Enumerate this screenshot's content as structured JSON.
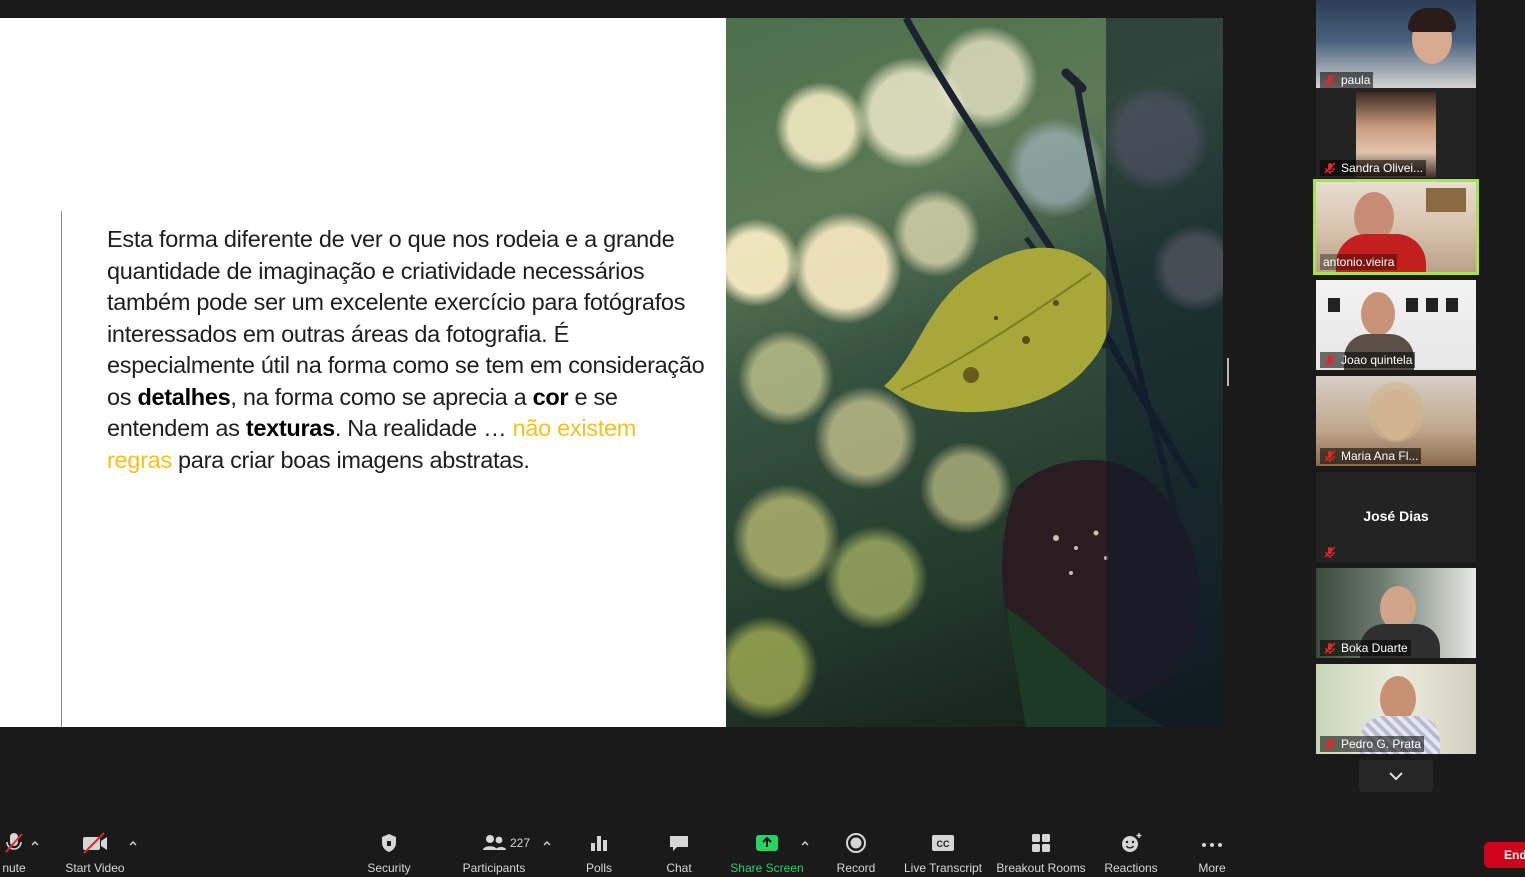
{
  "slide": {
    "text_parts": {
      "p1": "Esta forma diferente de ver o que nos rodeia e a grande quantidade de imaginação e criatividade necessários também pode ser um excelente exercício para fotógrafos interessados em outras áreas da fotografia. É especialmente útil na forma como se tem em consideração os ",
      "b1": "detalhes",
      "p2": ", na forma como se aprecia a ",
      "b2": "cor",
      "p3": " e se entendem as ",
      "b3": "texturas",
      "p4": ". Na realidade … ",
      "hl": "não existem regras",
      "p5": " para criar boas imagens abstratas."
    },
    "photo_alt": "bokeh leaf photo",
    "highlight_color": "#f2c11c"
  },
  "participants": [
    {
      "name": "paula",
      "muted": true
    },
    {
      "name": "Sandra Olivei...",
      "muted": true
    },
    {
      "name": "antonio.vieira",
      "muted": false,
      "active": true
    },
    {
      "name": "Joao quintela",
      "muted": true
    },
    {
      "name": "Maria Ana Fl...",
      "muted": true
    },
    {
      "name": "José Dias",
      "muted": true,
      "video_off": true
    },
    {
      "name": "Boka Duarte",
      "muted": true
    },
    {
      "name": "Pedro G. Prata",
      "muted": true
    }
  ],
  "toolbar": {
    "unmute_label": "nute",
    "start_video_label": "Start Video",
    "security_label": "Security",
    "participants_label": "Participants",
    "participants_count": "227",
    "polls_label": "Polls",
    "chat_label": "Chat",
    "share_screen_label": "Share Screen",
    "record_label": "Record",
    "live_transcript_label": "Live Transcript",
    "breakout_rooms_label": "Breakout Rooms",
    "reactions_label": "Reactions",
    "more_label": "More",
    "end_label": "End"
  },
  "colors": {
    "accent_green": "#25d366",
    "active_speaker": "#a8e34c",
    "end_red": "#d0021b",
    "muted_red": "#e02828"
  }
}
